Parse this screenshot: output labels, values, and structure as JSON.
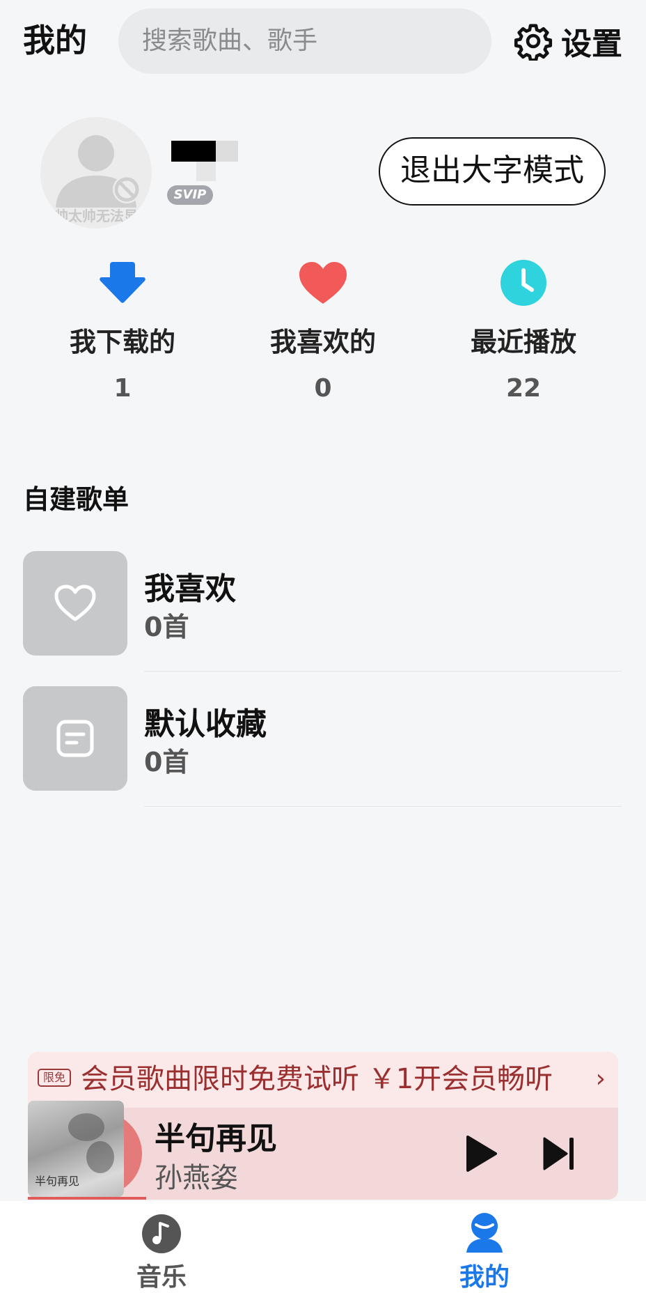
{
  "header": {
    "title": "我的",
    "search_placeholder": "搜索歌曲、歌手",
    "settings_label": "设置",
    "settings_icon": "gear-icon"
  },
  "profile": {
    "avatar_caption": "帅太帅无法显",
    "badge": "SVIP",
    "exit_large_text_label": "退出大字模式"
  },
  "stats": [
    {
      "label": "我下载的",
      "count": "1",
      "icon": "download-icon",
      "color": "#1a78e8"
    },
    {
      "label": "我喜欢的",
      "count": "0",
      "icon": "heart-icon",
      "color": "#f25a5a"
    },
    {
      "label": "最近播放",
      "count": "22",
      "icon": "clock-icon",
      "color": "#2fd3dd"
    }
  ],
  "playlists": {
    "section_title": "自建歌单",
    "items": [
      {
        "name": "我喜欢",
        "count": "0首",
        "icon": "heart-outline-icon"
      },
      {
        "name": "默认收藏",
        "count": "0首",
        "icon": "note-icon"
      }
    ]
  },
  "promo": {
    "tag": "限免",
    "text": "会员歌曲限时免费试听 ￥1开会员畅听",
    "chevron": "›"
  },
  "player": {
    "song": "半句再见",
    "artist": "孙燕姿",
    "art_text": "半句再见",
    "progress": 0.2
  },
  "tabbar": {
    "tabs": [
      {
        "label": "音乐",
        "icon": "music-note-icon",
        "active": false
      },
      {
        "label": "我的",
        "icon": "person-icon",
        "active": true
      }
    ],
    "active_color": "#1a78e8",
    "inactive_color": "#555555"
  }
}
